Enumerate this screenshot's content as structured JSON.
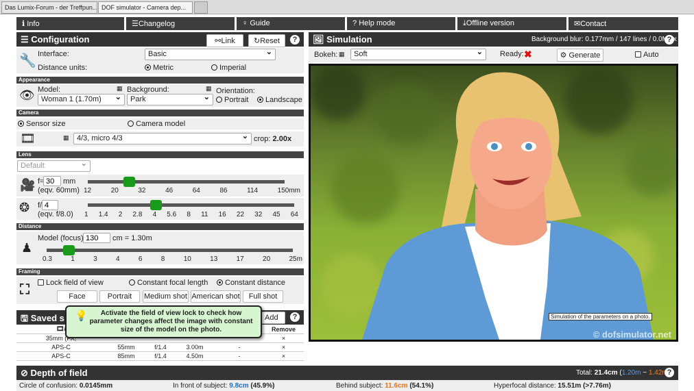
{
  "browser_tabs": [
    {
      "label": "Das Lumix-Forum - der Treffpun..."
    },
    {
      "label": "DOF simulator - Camera dep..."
    }
  ],
  "nav": {
    "info": "Info",
    "changelog": "Changelog",
    "guide": "Guide",
    "help": "Help mode",
    "offline": "Offline version",
    "contact": "Contact"
  },
  "config": {
    "title": "Configuration",
    "link": "Link",
    "reset": "Reset",
    "interface_label": "Interface:",
    "interface_value": "Basic",
    "units_label": "Distance units:",
    "metric": "Metric",
    "imperial": "Imperial"
  },
  "appearance": {
    "title": "Appearance",
    "model_label": "Model:",
    "model_value": "Woman 1 (1.70m)",
    "bg_label": "Background:",
    "bg_value": "Park",
    "orient_label": "Orientation:",
    "portrait": "Portrait",
    "landscape": "Landscape"
  },
  "camera": {
    "title": "Camera",
    "sensor_size": "Sensor size",
    "camera_model": "Camera model",
    "sensor_value": "4/3, micro 4/3",
    "crop_label": "crop:",
    "crop_value": "2.00x"
  },
  "lens": {
    "title": "Lens",
    "preset": "Default",
    "f_prefix": "f=",
    "focal": "30",
    "mm": "mm",
    "focal_eq": "(eqv. 60mm)",
    "focal_ticks": [
      "12",
      "20",
      "32",
      "46",
      "64",
      "86",
      "114",
      "150mm"
    ],
    "focal_pos": 0.21,
    "ap_prefix": "f/",
    "aperture": "4",
    "ap_eq": "(eqv. f/8.0)",
    "ap_ticks": [
      "1",
      "1.4",
      "2",
      "2.8",
      "4",
      "5.6",
      "8",
      "11",
      "16",
      "22",
      "32",
      "45",
      "64"
    ],
    "ap_pos": 0.33
  },
  "distance": {
    "title": "Distance",
    "label": "Model (focus):",
    "value": "130",
    "unit": "cm = 1.30m",
    "ticks": [
      "0.3",
      "1",
      "3",
      "4",
      "6",
      "8",
      "10",
      "13",
      "17",
      "20",
      "25m"
    ],
    "pos": 0.09
  },
  "framing": {
    "title": "Framing",
    "lock": "Lock field of view",
    "const_focal": "Constant focal length",
    "const_dist": "Constant distance",
    "buttons": [
      "Face",
      "Portrait",
      "Medium shot",
      "American shot",
      "Full shot"
    ]
  },
  "saved": {
    "title": "Saved s",
    "add": "Add",
    "remove_header": "Remove",
    "rows": [
      {
        "sensor": "35mm (FX,",
        "focal": "",
        "ap": "",
        "dist": "",
        "x": "",
        "rm": "×"
      },
      {
        "sensor": "APS-C",
        "focal": "55mm",
        "ap": "f/1.4",
        "dist": "3.00m",
        "x": "-",
        "rm": "×"
      },
      {
        "sensor": "APS-C",
        "focal": "85mm",
        "ap": "f/1.4",
        "dist": "4.50m",
        "x": "-",
        "rm": "×"
      }
    ]
  },
  "tooltip": "Activate the field of view lock to check how parameter changes affect the image with constant size of the model on the photo.",
  "simulation": {
    "title": "Simulation",
    "blur": "Background blur: 0.177mm / 147 lines / 0.0Mpix",
    "bokeh_label": "Bokeh:",
    "bokeh_value": "Soft",
    "ready_label": "Ready:",
    "generate": "Generate",
    "auto": "Auto",
    "photo_tooltip": "Simulation of the parameters on a photo.",
    "watermark": "© dofsimulator.net"
  },
  "dof": {
    "title": "Depth of field",
    "total_label": "Total:",
    "total": "21.4cm",
    "near": "1.20m",
    "sep": "~",
    "far": "1.42m",
    "coc_label": "Circle of confusion:",
    "coc": "0.0145mm",
    "front_label": "In front of subject:",
    "front": "9.8cm",
    "front_pct": "(45.9%)",
    "behind_label": "Behind subject:",
    "behind": "11.6cm",
    "behind_pct": "(54.1%)",
    "hyper_label": "Hyperfocal distance:",
    "hyper": "15.51m (>7.76m)"
  },
  "colors": {
    "accent_green": "#1a9a1a",
    "near_blue": "#1e6fd0",
    "far_orange": "#e8731a",
    "ready_red": "#d11"
  }
}
